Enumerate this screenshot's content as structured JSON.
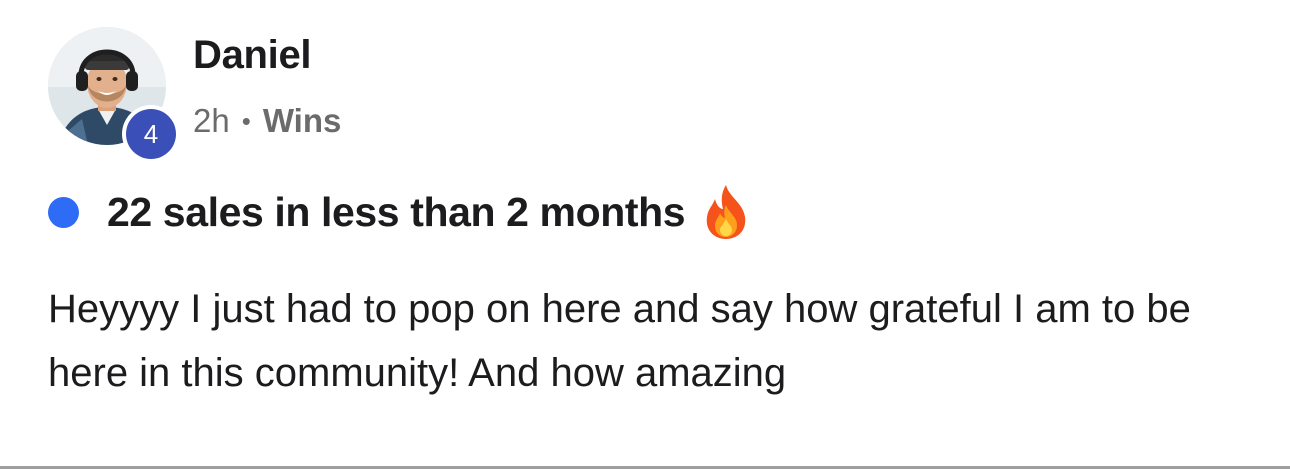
{
  "post": {
    "author": {
      "name": "Daniel",
      "level": "4"
    },
    "meta": {
      "time": "2h",
      "separator": "•",
      "category": "Wins"
    },
    "title": "22 sales in less than 2 months",
    "title_emoji": "fire-icon",
    "body": "Heyyyy I just had to pop on here and say how grateful I am to be here in this community! And how amazing"
  },
  "colors": {
    "unread_dot": "#2f6cf6",
    "level_badge": "#3b4fb8",
    "meta_text": "#6b6b6b",
    "divider": "#9e9e9e"
  }
}
